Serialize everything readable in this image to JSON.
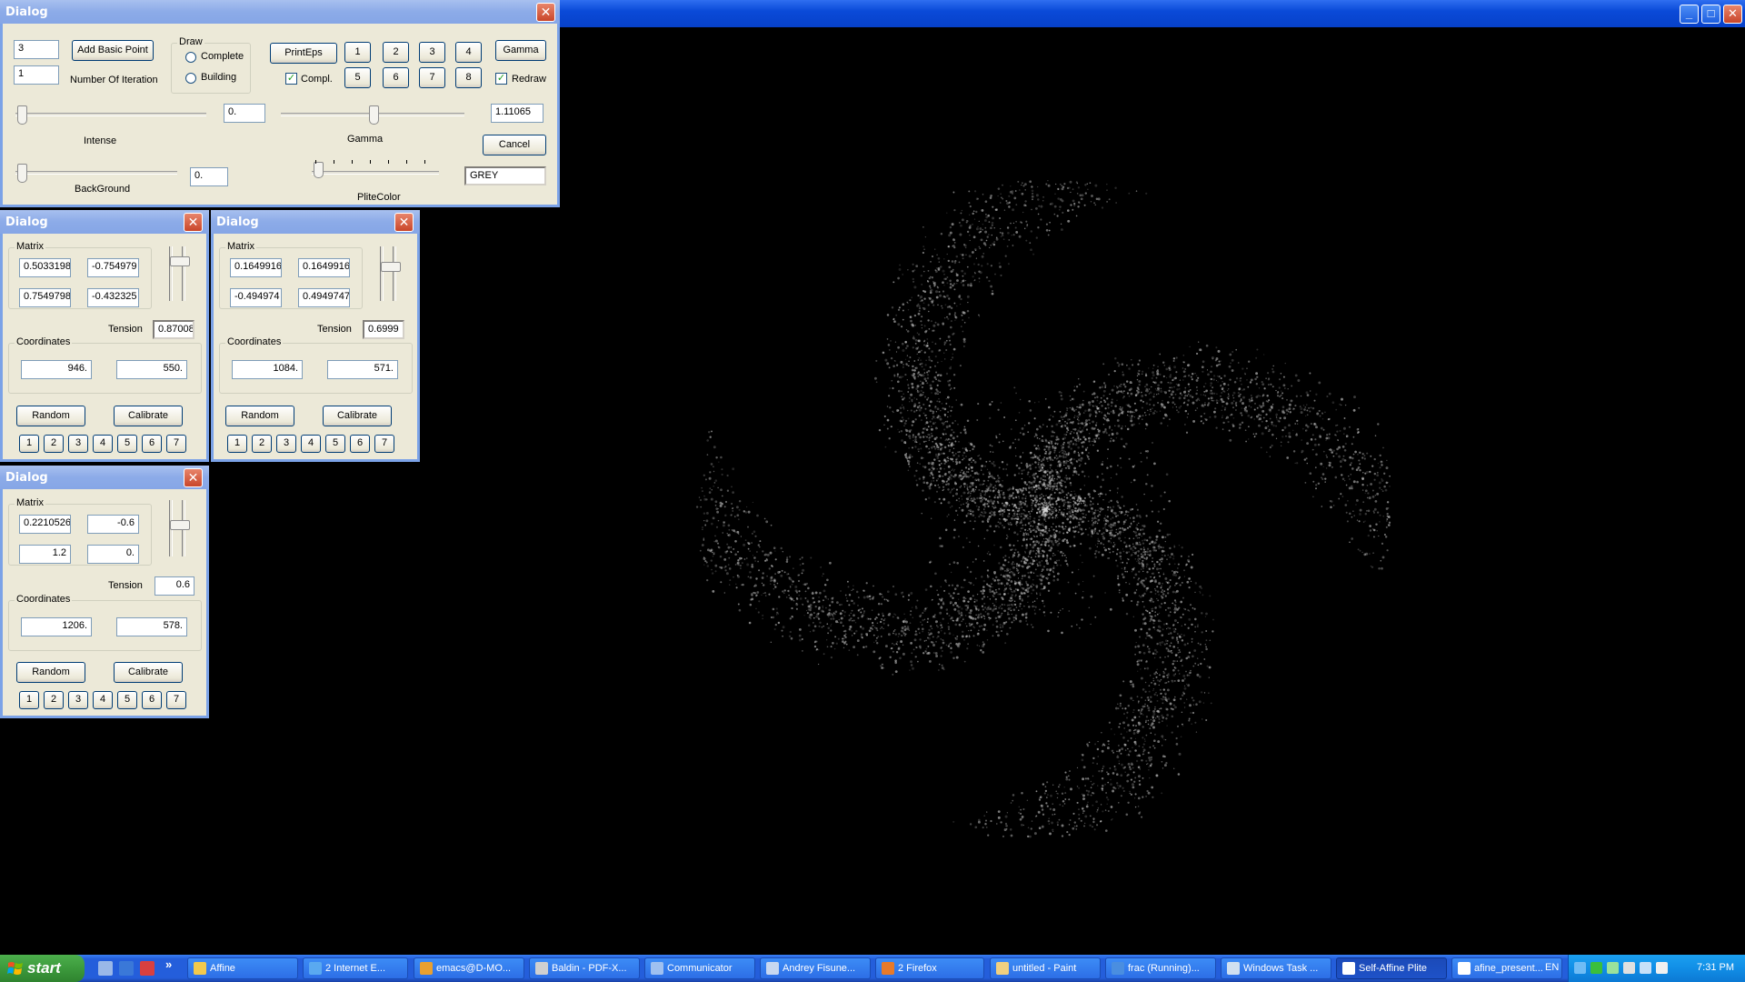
{
  "main_window": {
    "buttons": [
      "_",
      "□",
      "✕"
    ]
  },
  "control_dialog": {
    "title": "Dialog",
    "basic_point_count": "3",
    "iteration_count": "1",
    "add_basic_point_label": "Add Basic Point",
    "number_of_iteration_label": "Number Of Iteration",
    "draw_group_title": "Draw",
    "draw_options": [
      "Complete",
      "Building"
    ],
    "print_eps_label": "PrintEps",
    "compl_label": "Compl.",
    "compl_checked": true,
    "number_buttons_top": [
      "1",
      "2",
      "3",
      "4"
    ],
    "number_buttons_bottom": [
      "5",
      "6",
      "7",
      "8"
    ],
    "gamma_button_label": "Gamma",
    "redraw_label": "Redraw",
    "redraw_checked": true,
    "intense_value": "0.",
    "intense_label": "Intense",
    "gamma_value": "1.11065",
    "gamma_label": "Gamma",
    "cancel_label": "Cancel",
    "background_value": "0.",
    "background_label": "BackGround",
    "plite_color_label": "PliteColor",
    "plite_color_value": "GREY"
  },
  "transform_dialogs": [
    {
      "title": "Dialog",
      "matrix_title": "Matrix",
      "matrix": [
        "0.5033198",
        "-0.754979",
        "0.7549798",
        "-0.432325"
      ],
      "tension_label": "Tension",
      "tension": "0.87008",
      "coordinates_title": "Coordinates",
      "coord_x": "946.",
      "coord_y": "550.",
      "random_label": "Random",
      "calibrate_label": "Calibrate",
      "number_buttons": [
        "1",
        "2",
        "3",
        "4",
        "5",
        "6",
        "7"
      ]
    },
    {
      "title": "Dialog",
      "matrix_title": "Matrix",
      "matrix": [
        "0.1649916",
        "0.1649916",
        "-0.494974",
        "0.4949747"
      ],
      "tension_label": "Tension",
      "tension": "0.6999",
      "coordinates_title": "Coordinates",
      "coord_x": "1084.",
      "coord_y": "571.",
      "random_label": "Random",
      "calibrate_label": "Calibrate",
      "number_buttons": [
        "1",
        "2",
        "3",
        "4",
        "5",
        "6",
        "7"
      ]
    },
    {
      "title": "Dialog",
      "matrix_title": "Matrix",
      "matrix": [
        "0.2210526",
        "-0.6",
        "1.2",
        "0."
      ],
      "tension_label": "Tension",
      "tension": "0.6",
      "coordinates_title": "Coordinates",
      "coord_x": "1206.",
      "coord_y": "578.",
      "random_label": "Random",
      "calibrate_label": "Calibrate",
      "number_buttons": [
        "1",
        "2",
        "3",
        "4",
        "5",
        "6",
        "7"
      ]
    }
  ],
  "taskbar": {
    "start_label": "start",
    "tasks": [
      {
        "label": "Affine",
        "icon_color": "#f2c94c"
      },
      {
        "label": "2 Internet E...",
        "icon_color": "#5aa9f0"
      },
      {
        "label": "emacs@D-MO...",
        "icon_color": "#e8a030"
      },
      {
        "label": "Baldin - PDF-X...",
        "icon_color": "#d0d0d0"
      },
      {
        "label": "Communicator",
        "icon_color": "#9fc0f0"
      },
      {
        "label": "Andrey Fisune...",
        "icon_color": "#c8d8f0"
      },
      {
        "label": "2 Firefox",
        "icon_color": "#e87a2a"
      },
      {
        "label": "untitled - Paint",
        "icon_color": "#f0d080"
      },
      {
        "label": "frac (Running)...",
        "icon_color": "#4a8ee0"
      },
      {
        "label": "Windows Task ...",
        "icon_color": "#d0e0f0"
      },
      {
        "label": "Self-Affine Plite",
        "icon_color": "#ffffff"
      },
      {
        "label": "afine_present...",
        "icon_color": "#ffffff"
      }
    ],
    "language": "EN",
    "clock": "7:31 PM"
  },
  "colors": {
    "title_bar": "#0a4ad8",
    "dialog_bg": "#ece9d8",
    "taskbar": "#245edb",
    "start_button": "#3c9a3c",
    "fractal_color": "#d8d8d8"
  }
}
